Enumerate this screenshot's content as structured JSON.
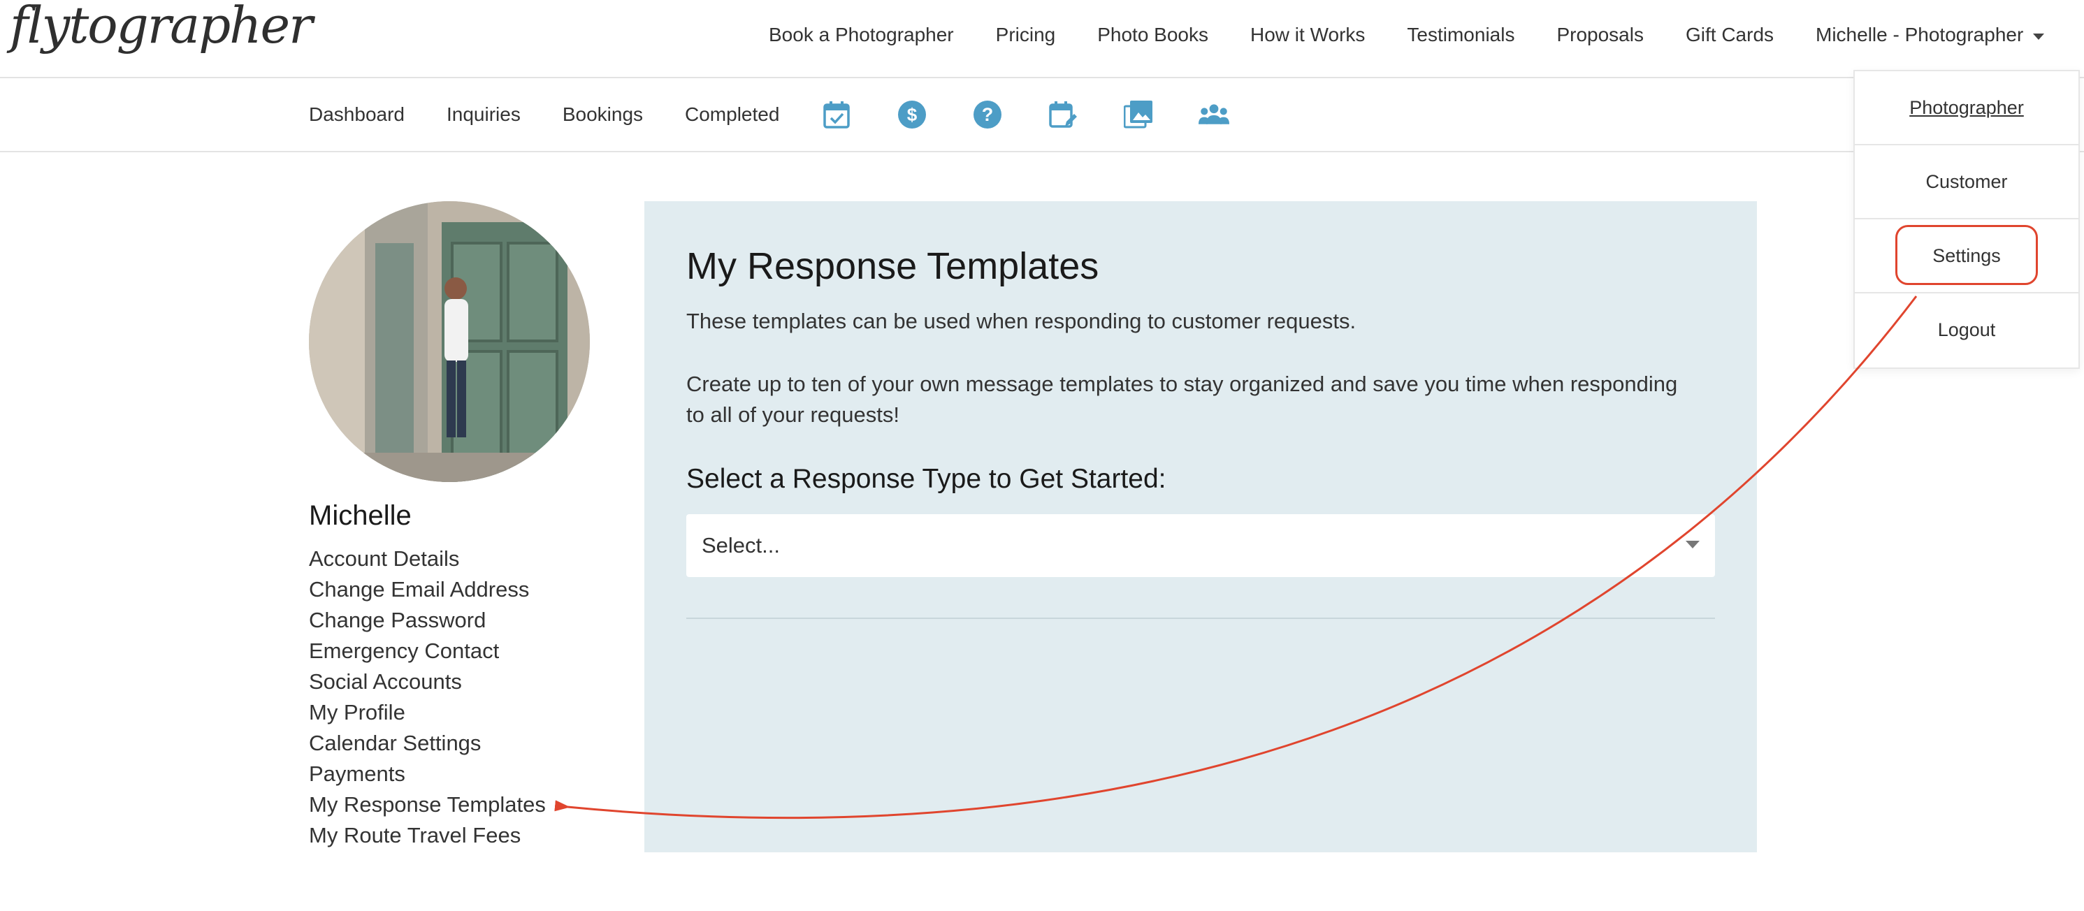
{
  "brand": {
    "logo_text": "flytographer"
  },
  "top_nav": {
    "items": [
      "Book a Photographer",
      "Pricing",
      "Photo Books",
      "How it Works",
      "Testimonials",
      "Proposals",
      "Gift Cards"
    ],
    "user_menu_label": "Michelle - Photographer"
  },
  "sub_nav": {
    "links": [
      "Dashboard",
      "Inquiries",
      "Bookings",
      "Completed"
    ],
    "icons": [
      "calendar-check-icon",
      "dollar-circle-icon",
      "help-circle-icon",
      "calendar-edit-icon",
      "image-gallery-icon",
      "group-icon"
    ]
  },
  "dropdown": {
    "items": [
      "Photographer",
      "Customer",
      "Settings",
      "Logout"
    ],
    "active_item": "Photographer",
    "highlighted_item": "Settings"
  },
  "sidebar": {
    "name": "Michelle",
    "menu": [
      "Account Details",
      "Change Email Address",
      "Change Password",
      "Emergency Contact",
      "Social Accounts",
      "My Profile",
      "Calendar Settings",
      "Payments",
      "My Response Templates",
      "My Route Travel Fees"
    ]
  },
  "main": {
    "title": "My Response Templates",
    "description": "These templates can be used when responding to customer requests.",
    "description2": "Create up to ten of your own message templates to stay organized and save you time when responding to all of your requests!",
    "select_heading": "Select a Response Type to Get Started:",
    "select_value": "Select..."
  },
  "colors": {
    "icon_accent": "#4d9dc6",
    "panel_bg": "#e1ecf0",
    "annotation": "#e0452e"
  }
}
